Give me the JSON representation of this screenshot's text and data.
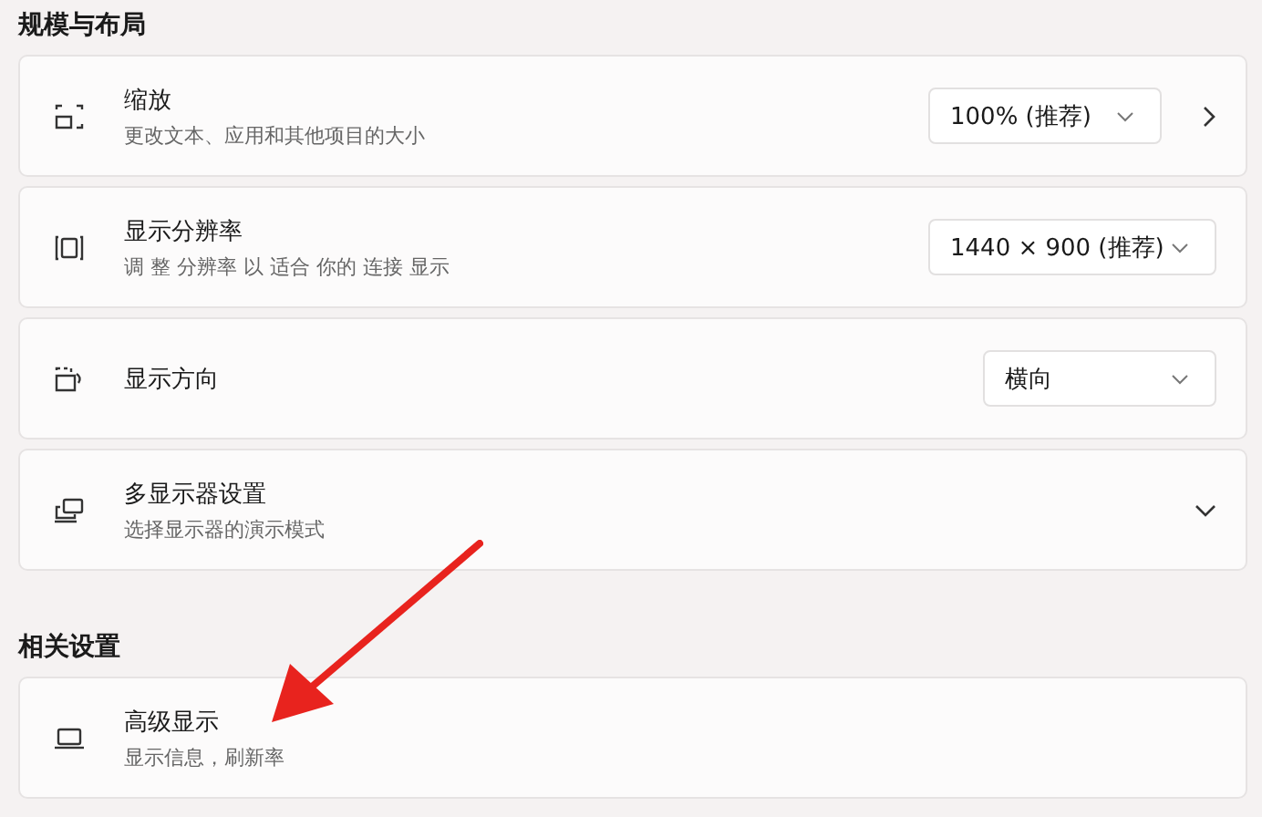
{
  "sections": [
    {
      "heading": "规模与布局",
      "rows": [
        {
          "title": "缩放",
          "subtitle": "更改文本、应用和其他项目的大小",
          "dropdown": {
            "value": "100% (推荐)"
          },
          "kind": "link"
        },
        {
          "title": "显示分辨率",
          "subtitle": "调 整 分辨率 以 适合 你的 连接 显示",
          "dropdown": {
            "value": "1440 × 900 (推荐)"
          }
        },
        {
          "title": "显示方向",
          "dropdown": {
            "value": "横向"
          }
        },
        {
          "title": "多显示器设置",
          "subtitle": "选择显示器的演示模式",
          "kind": "expander"
        }
      ]
    },
    {
      "heading": "相关设置",
      "rows": [
        {
          "title": "高级显示",
          "subtitle": "显示信息，刷新率"
        }
      ]
    }
  ]
}
